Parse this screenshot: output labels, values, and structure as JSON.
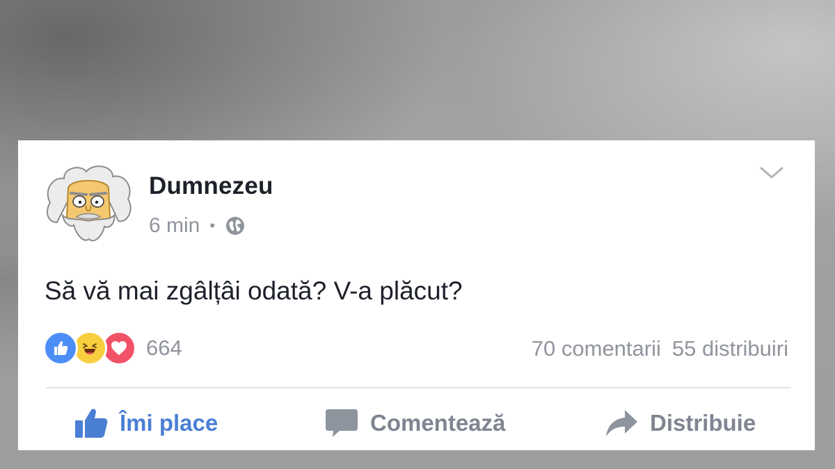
{
  "post": {
    "author": "Dumnezeu",
    "time": "6 min",
    "separator": "•",
    "privacy_icon": "globe-icon",
    "text": "Să vă mai zgâlțâi odată? V-a plăcut?",
    "reactions": {
      "types": [
        "like",
        "haha",
        "love"
      ],
      "count": "664"
    },
    "comments_count": "70 comentarii",
    "shares_count": "55 distribuiri"
  },
  "actions": {
    "like_label": "Îmi place",
    "comment_label": "Comentează",
    "share_label": "Distribuie"
  },
  "colors": {
    "like_blue": "#4a7fd4",
    "muted_gray": "#90949c",
    "text": "#1d2129",
    "love_red": "#f25268",
    "haha_yellow": "#f7cf3f",
    "like_reaction_blue": "#4c8ef5"
  }
}
